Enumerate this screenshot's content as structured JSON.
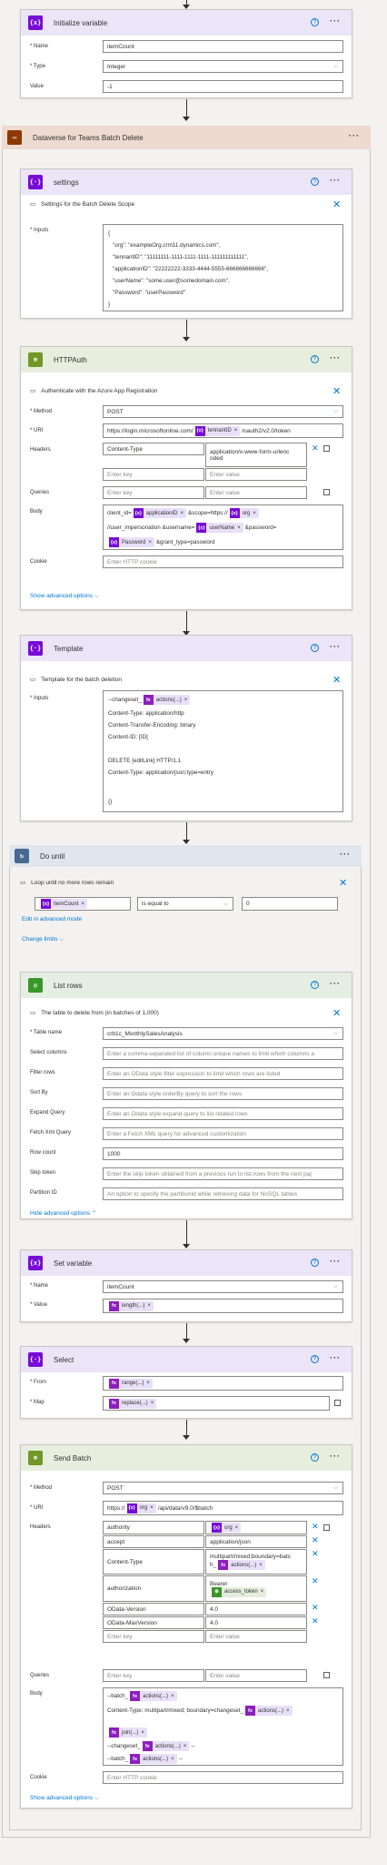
{
  "init_variable": {
    "title": "Initialize variable",
    "fields": {
      "name_label": "* Name",
      "name_value": "itemCount",
      "type_label": "* Type",
      "type_value": "Integer",
      "value_label": "Value",
      "value_value": "-1"
    }
  },
  "scope": {
    "title": "Dataverse for Teams Batch Delete"
  },
  "settings": {
    "title": "settings",
    "description": "Settings for the Batch Delete Scope",
    "inputs_label": "* Inputs",
    "json_lines": [
      "{",
      "\"org\": \"exampleOrg.crm11.dynamics.com\",",
      "\"tennantID\": \"11111111-1111-1111-1111-111111111111\",",
      "\"applicationID\": \"22222222-3333-4444-5555-666666666666\",",
      "\"userName\": \"some.user@somedomain.com\",",
      "\"Password\": \"userPassword\"",
      "}"
    ]
  },
  "httpauth": {
    "title": "HTTPAuth",
    "description": "Authenticate with the Azure App Registration",
    "method_label": "* Method",
    "method_value": "POST",
    "uri_label": "* URI",
    "uri_prefix": "https://login.microsoftonline.com/",
    "uri_token": "tennantID",
    "uri_suffix": "/oauth2/v2.0/token",
    "headers_label": "Headers",
    "header_key": "Content-Type",
    "header_value_1": "application/x-www-form-urlenc",
    "header_value_2": "oded",
    "enter_key": "Enter key",
    "enter_value": "Enter value",
    "queries_label": "Queries",
    "body_label": "Body",
    "body_t1": "client_id=",
    "body_tok1": "applicationID",
    "body_t2": "&scope=https://",
    "body_tok2": "org",
    "body_t3": "//user_impersonation &username=",
    "body_tok3": "userName",
    "body_t4": "&password=",
    "body_tok4": "Password",
    "body_t5": "&grant_type=password",
    "cookie_label": "Cookie",
    "cookie_placeholder": "Enter HTTP cookie",
    "show_advanced": "Show advanced options"
  },
  "template": {
    "title": "Template",
    "description": "Template for the batch deletion",
    "inputs_label": "* Inputs",
    "line1_prefix": "--changeset_",
    "line1_token": "actions(...)",
    "lines": [
      "Content-Type: application/http",
      "Content-Transfer-Encoding: binary",
      "Content-ID: [ID]",
      "",
      "DELETE [editLink] HTTP/1.1",
      "Content-Type: application/json;type=entry",
      "",
      "{}"
    ]
  },
  "do_until": {
    "title": "Do until",
    "description": "Loop until no more rows remain",
    "cond_token": "itemCount",
    "cond_operator": "is equal to",
    "cond_value": "0",
    "edit_advanced": "Edit in advanced mode",
    "change_limits": "Change limits"
  },
  "list_rows": {
    "title": "List rows",
    "description": "The table to delete from (in batches of 1,000)",
    "table_label": "* Table name",
    "table_value": "crb1c_MonthlySalesAnalysis",
    "select_label": "Select columns",
    "select_ph": "Enter a comma-separated list of column unique names to limit which columns a",
    "filter_label": "Filter rows",
    "filter_ph": "Enter an OData style filter expression to limit which rows are listed",
    "sort_label": "Sort By",
    "sort_ph": "Enter an Odata style orderBy query to sort the rows",
    "expand_label": "Expand Query",
    "expand_ph": "Enter an Odata style expand query to list related rows",
    "fetch_label": "Fetch Xml Query",
    "fetch_ph": "Enter a Fetch XML query for advanced customization",
    "rowcount_label": "Row count",
    "rowcount_value": "1000",
    "skip_label": "Skip token",
    "skip_ph": "Enter the skip token obtained from a previous run to list rows from the next pa|",
    "partition_label": "Partition ID",
    "partition_ph": "An option to specify the partitionId while retrieving data for NoSQL tables",
    "hide_advanced": "Hide advanced options"
  },
  "set_variable": {
    "title": "Set variable",
    "name_label": "* Name",
    "name_value": "itemCount",
    "value_label": "* Value",
    "value_token": "length(...)"
  },
  "select": {
    "title": "Select",
    "from_label": "* From",
    "from_token": "range(...)",
    "map_label": "* Map",
    "map_token": "replace(...)"
  },
  "send_batch": {
    "title": "Send Batch",
    "method_label": "* Method",
    "method_value": "POST",
    "uri_label": "* URI",
    "uri_prefix": "https://",
    "uri_token": "org",
    "uri_suffix": "/api/data/v9.0/$batch",
    "headers_label": "Headers",
    "headers": [
      {
        "key": "authority",
        "token": "org"
      },
      {
        "key": "accept",
        "value": "application/json"
      },
      {
        "key": "Content-Type",
        "value": "multipart/mixed;boundary=batc",
        "value2": "h_",
        "token": "actions(...)"
      },
      {
        "key": "authorization",
        "value": "Bearer",
        "token": "access_token"
      },
      {
        "key": "OData-Version",
        "value": "4.0"
      },
      {
        "key": "OData-MaxVersion",
        "value": "4.0"
      }
    ],
    "enter_key": "Enter key",
    "enter_value": "Enter value",
    "queries_label": "Queries",
    "body_label": "Body",
    "body_l1_prefix": "--batch_",
    "body_l1_token": "actions(...)",
    "body_l2_prefix": "Content-Type: multipart/mixed; boundary=changeset_",
    "body_l2_token": "actions(...)",
    "body_l3_token": "join(...)",
    "body_l4_prefix": "--changeset_",
    "body_l4_token": "actions(...)",
    "body_l4_suffix": "--",
    "body_l5_prefix": "--batch_",
    "body_l5_token": "actions(...)",
    "body_l5_suffix": "--",
    "cookie_label": "Cookie",
    "cookie_placeholder": "Enter HTTP cookie",
    "show_advanced": "Show advanced options"
  },
  "colors": {
    "variable": "#770bd6",
    "scope": "#8c3900",
    "dataverse": "#3a9628",
    "loop": "#486991",
    "http": "#709727",
    "accent": "#0078d4"
  }
}
